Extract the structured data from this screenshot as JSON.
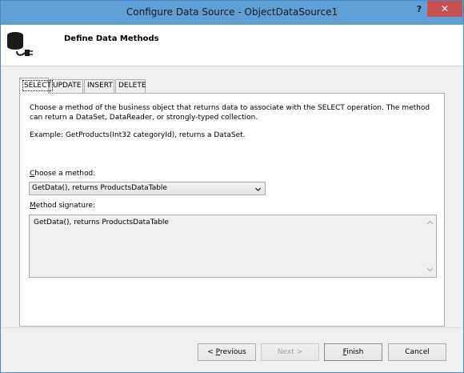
{
  "window": {
    "title": "Configure Data Source - ObjectDataSource1",
    "help_label": "?",
    "close_label": "✕"
  },
  "header": {
    "title": "Define Data Methods",
    "icon": "database-plug-icon"
  },
  "tabs": [
    {
      "label": "SELECT",
      "active": true
    },
    {
      "label": "UPDATE",
      "active": false
    },
    {
      "label": "INSERT",
      "active": false
    },
    {
      "label": "DELETE",
      "active": false
    }
  ],
  "select_panel": {
    "description": "Choose a method of the business object that returns data to associate with the SELECT operation. The method can return a DataSet, DataReader, or strongly-typed collection.",
    "example": "Example: GetProducts(Int32 categoryId), returns a DataSet.",
    "method_label_key": "C",
    "method_label_rest": "hoose a method:",
    "method_value": "GetData(), returns ProductsDataTable",
    "signature_label_key": "M",
    "signature_label_rest": "ethod signature:",
    "signature_value": "GetData(), returns ProductsDataTable"
  },
  "buttons": {
    "previous_prefix": "< ",
    "previous_key": "P",
    "previous_rest": "revious",
    "next": "Next >",
    "finish_key": "F",
    "finish_rest": "inish",
    "cancel": "Cancel"
  },
  "colors": {
    "titlebar": "#5e9fd6",
    "close": "#c75050"
  }
}
